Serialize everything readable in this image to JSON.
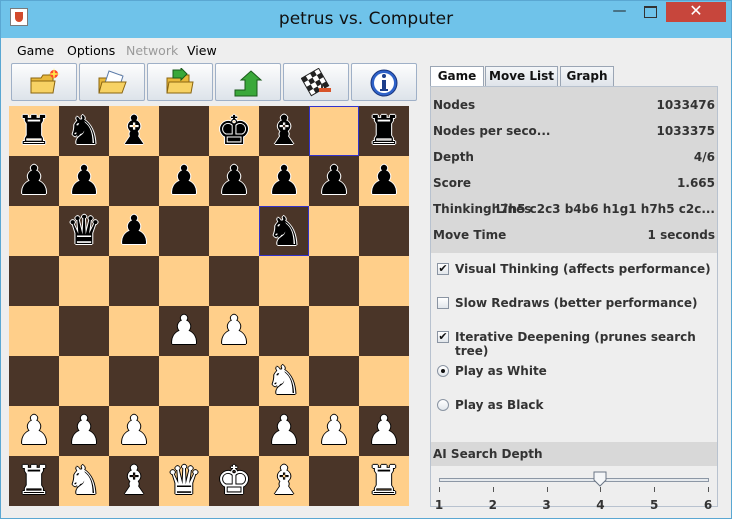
{
  "window": {
    "title": "petrus vs. Computer",
    "close_glyph": "✕",
    "minimize_glyph": "—"
  },
  "menu": [
    {
      "label": "Game",
      "enabled": true
    },
    {
      "label": "Options",
      "enabled": true
    },
    {
      "label": "Network",
      "enabled": false
    },
    {
      "label": "View",
      "enabled": true
    }
  ],
  "toolbar": [
    {
      "icon": "new-game-icon"
    },
    {
      "icon": "open-icon"
    },
    {
      "icon": "save-icon"
    },
    {
      "icon": "undo-icon"
    },
    {
      "icon": "board-settings-icon"
    },
    {
      "icon": "info-icon"
    }
  ],
  "board": {
    "light_color": "#ffcf8a",
    "dark_color": "#4a3528",
    "highlight_color": "#3333cc",
    "highlighted_squares": [
      "g8",
      "f6"
    ],
    "pieces": [
      {
        "square": "a8",
        "piece": "rook",
        "color": "black",
        "glyph": "♜"
      },
      {
        "square": "b8",
        "piece": "knight",
        "color": "black",
        "glyph": "♞"
      },
      {
        "square": "c8",
        "piece": "bishop",
        "color": "black",
        "glyph": "♝"
      },
      {
        "square": "e8",
        "piece": "king",
        "color": "black",
        "glyph": "♚"
      },
      {
        "square": "f8",
        "piece": "bishop",
        "color": "black",
        "glyph": "♝"
      },
      {
        "square": "h8",
        "piece": "rook",
        "color": "black",
        "glyph": "♜"
      },
      {
        "square": "a7",
        "piece": "pawn",
        "color": "black",
        "glyph": "♟"
      },
      {
        "square": "b7",
        "piece": "pawn",
        "color": "black",
        "glyph": "♟"
      },
      {
        "square": "d7",
        "piece": "pawn",
        "color": "black",
        "glyph": "♟"
      },
      {
        "square": "e7",
        "piece": "pawn",
        "color": "black",
        "glyph": "♟"
      },
      {
        "square": "f7",
        "piece": "pawn",
        "color": "black",
        "glyph": "♟"
      },
      {
        "square": "g7",
        "piece": "pawn",
        "color": "black",
        "glyph": "♟"
      },
      {
        "square": "h7",
        "piece": "pawn",
        "color": "black",
        "glyph": "♟"
      },
      {
        "square": "b6",
        "piece": "queen",
        "color": "black",
        "glyph": "♛"
      },
      {
        "square": "c6",
        "piece": "pawn",
        "color": "black",
        "glyph": "♟"
      },
      {
        "square": "f6",
        "piece": "knight",
        "color": "black",
        "glyph": "♞"
      },
      {
        "square": "d4",
        "piece": "pawn",
        "color": "white",
        "glyph": "♟"
      },
      {
        "square": "e4",
        "piece": "pawn",
        "color": "white",
        "glyph": "♟"
      },
      {
        "square": "f3",
        "piece": "knight",
        "color": "white",
        "glyph": "♞"
      },
      {
        "square": "a2",
        "piece": "pawn",
        "color": "white",
        "glyph": "♟"
      },
      {
        "square": "b2",
        "piece": "pawn",
        "color": "white",
        "glyph": "♟"
      },
      {
        "square": "c2",
        "piece": "pawn",
        "color": "white",
        "glyph": "♟"
      },
      {
        "square": "f2",
        "piece": "pawn",
        "color": "white",
        "glyph": "♟"
      },
      {
        "square": "g2",
        "piece": "pawn",
        "color": "white",
        "glyph": "♟"
      },
      {
        "square": "h2",
        "piece": "pawn",
        "color": "white",
        "glyph": "♟"
      },
      {
        "square": "a1",
        "piece": "rook",
        "color": "white",
        "glyph": "♜"
      },
      {
        "square": "b1",
        "piece": "knight",
        "color": "white",
        "glyph": "♞"
      },
      {
        "square": "c1",
        "piece": "bishop",
        "color": "white",
        "glyph": "♝"
      },
      {
        "square": "d1",
        "piece": "queen",
        "color": "white",
        "glyph": "♛"
      },
      {
        "square": "e1",
        "piece": "king",
        "color": "white",
        "glyph": "♚"
      },
      {
        "square": "f1",
        "piece": "bishop",
        "color": "white",
        "glyph": "♝"
      },
      {
        "square": "h1",
        "piece": "rook",
        "color": "white",
        "glyph": "♜"
      }
    ]
  },
  "panel": {
    "tabs": [
      {
        "label": "Game",
        "active": true
      },
      {
        "label": "Move List",
        "active": false
      },
      {
        "label": "Graph",
        "active": false
      }
    ],
    "stats": [
      {
        "label": "Nodes",
        "value": "1033476"
      },
      {
        "label": "Nodes per seco...",
        "value": "1033375"
      },
      {
        "label": "Depth",
        "value": "4/6"
      },
      {
        "label": "Score",
        "value": "1.665"
      },
      {
        "label": "Thinking Lines",
        "value": "h7h5 c2c3 b4b6 h1g1 h7h5 c2c..."
      },
      {
        "label": "Move Time",
        "value": "1 seconds"
      }
    ],
    "options": [
      {
        "type": "checkbox",
        "label": "Visual Thinking (affects performance)",
        "checked": true,
        "mark": "✔"
      },
      {
        "type": "checkbox",
        "label": "Slow Redraws (better performance)",
        "checked": false,
        "mark": "✔"
      },
      {
        "type": "checkbox",
        "label": "Iterative Deepening (prunes search tree)",
        "checked": true,
        "mark": "✔"
      },
      {
        "type": "radio",
        "label": "Play as White",
        "checked": true
      },
      {
        "type": "radio",
        "label": "Play as Black",
        "checked": false
      }
    ],
    "depth": {
      "label": "AI Search Depth",
      "min": 1,
      "max": 6,
      "value": 4,
      "tick_labels": [
        "1",
        "2",
        "3",
        "4",
        "5",
        "6"
      ]
    }
  }
}
